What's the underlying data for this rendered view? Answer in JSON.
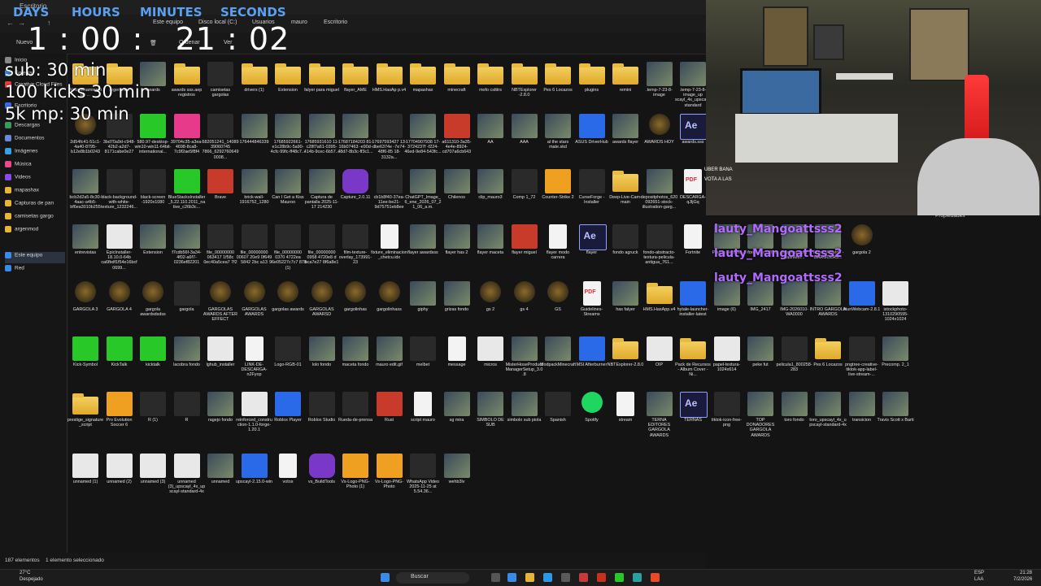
{
  "window": {
    "title": "Escritorio"
  },
  "address": {
    "back_icon": "arrow-left-icon",
    "crumbs": [
      "Este equipo",
      "Disco local (C:)",
      "Usuarios",
      "mauro",
      "Escritorio"
    ]
  },
  "cmdbar": {
    "new_label": "Nuevo",
    "sort_label": "Ordenar",
    "view_label": "Ver"
  },
  "sidebar": {
    "items": [
      {
        "label": "Inicio",
        "icon": "home-icon",
        "color": "#888888"
      },
      {
        "label": "Galería",
        "icon": "gallery-icon",
        "color": "#3a8ae8"
      },
      {
        "label": "Creative Cloud Files",
        "icon": "cloud-icon",
        "color": "#e83a3a"
      },
      {
        "label": "Escritorio",
        "icon": "desktop-icon",
        "color": "#3a6ae8"
      },
      {
        "label": "Descargas",
        "icon": "download-icon",
        "color": "#3a9a5a"
      },
      {
        "label": "Documentos",
        "icon": "documents-icon",
        "color": "#6a8ad8"
      },
      {
        "label": "Imágenes",
        "icon": "pictures-icon",
        "color": "#3aa0e8"
      },
      {
        "label": "Música",
        "icon": "music-icon",
        "color": "#e84a8a"
      },
      {
        "label": "Videos",
        "icon": "video-icon",
        "color": "#8a4ae8"
      },
      {
        "label": "mapashax",
        "icon": "folder-icon",
        "color": "#e8b43a"
      },
      {
        "label": "Capturas de pan",
        "icon": "folder-icon",
        "color": "#e8b43a"
      },
      {
        "label": "camisetas gargo",
        "icon": "folder-icon",
        "color": "#e8b43a"
      },
      {
        "label": "argenmod",
        "icon": "folder-icon",
        "color": "#e8b43a"
      },
      {
        "label": "Este equipo",
        "icon": "computer-icon",
        "color": "#3a8ae8"
      },
      {
        "label": "Red",
        "icon": "network-icon",
        "color": "#3a8ae8"
      }
    ]
  },
  "files": {
    "row1": [
      {
        "name": "Almacenamiento de ...",
        "kind": "folder"
      },
      {
        "name": "argenmod",
        "kind": "folder"
      },
      {
        "name": "awards",
        "kind": "img"
      },
      {
        "name": "awards sss.aep registros",
        "kind": "folder"
      },
      {
        "name": "camisetas gargolas",
        "kind": "dark"
      },
      {
        "name": "drivers (1)",
        "kind": "folder"
      },
      {
        "name": "Extension",
        "kind": "folder"
      },
      {
        "name": "falyer para miguel",
        "kind": "folder"
      },
      {
        "name": "flayer_AME",
        "kind": "folder"
      },
      {
        "name": "HMS.HasAp p.v4",
        "kind": "folder"
      },
      {
        "name": "mapashax",
        "kind": "folder"
      },
      {
        "name": "minecraft",
        "kind": "folder"
      },
      {
        "name": "mofo cstttrs",
        "kind": "folder"
      },
      {
        "name": "NBTExplorer -2.8.0",
        "kind": "folder"
      },
      {
        "name": "Pes 6 Locazos",
        "kind": "folder"
      },
      {
        "name": "plugins",
        "kind": "folder"
      },
      {
        "name": "remini",
        "kind": "folder"
      },
      {
        "name": ".temp-7-23-8-image",
        "kind": "img"
      },
      {
        "name": ".temp-7-23-8-image_up scayl_4x_upscayl-standard",
        "kind": "img"
      }
    ],
    "row2": [
      {
        "name": "2d54fc41-51c1-4a40-8795-b12e8b1b0243",
        "kind": "gold"
      },
      {
        "name": "3bd70a9d-c948-42b2-a2d7-8171cabe0e27",
        "kind": "dark"
      },
      {
        "name": "580.97-desktop-win10-win11-64bit-international...",
        "kind": "green"
      },
      {
        "name": "39704c35-a3ea-4698-8ca8-7c9f2ae5f8f4",
        "kind": "pink"
      },
      {
        "name": "582051241_1408939060745 7866_62927606490008...",
        "kind": "dark"
      },
      {
        "name": "176444846339",
        "kind": "img"
      },
      {
        "name": "17685922661-e1c28b9c-5a90-4cfc-99fc-ff48c7...",
        "kind": "img"
      },
      {
        "name": "17685931610 11-c28f7a61-0395-414b-9cec-6b57...",
        "kind": "img"
      },
      {
        "name": "17687184203 81-16b07463 -e90d-48d7-8b3c-ff3c1...",
        "kind": "img"
      },
      {
        "name": "17697593427 13-dbe6374e -7e74-48f6-85 18-3132a...",
        "kind": "dark"
      },
      {
        "name": "17704907938 17-3724237f -f224-46ed-9e84-543fc...",
        "kind": "img"
      },
      {
        "name": "a611310-3a35-4e4e-8924-cd707a6cb643",
        "kind": "red"
      },
      {
        "name": "AA",
        "kind": "img"
      },
      {
        "name": "AAA",
        "kind": "img"
      },
      {
        "name": "al the stars mate.skd",
        "kind": "img"
      },
      {
        "name": "ASUS DriverHub",
        "kind": "blue"
      },
      {
        "name": "awards flayer",
        "kind": "img"
      },
      {
        "name": "AWARDS HOY",
        "kind": "gold"
      },
      {
        "name": "awards.sss",
        "kind": "ae"
      }
    ],
    "row3": [
      {
        "name": "bcb2d2a5-8c30-4aac-a4b5-bf6ea3010b255",
        "kind": "img"
      },
      {
        "name": "black-background-with-white-texture_1232246...",
        "kind": "dark"
      },
      {
        "name": "black-screen -1920x1080",
        "kind": "dark"
      },
      {
        "name": "BlueStacksInstaller_5.22.110.2011_native_c26b3c...",
        "kind": "green"
      },
      {
        "name": "Brave",
        "kind": "red"
      },
      {
        "name": "brick-wall-1916752_1280",
        "kind": "img"
      },
      {
        "name": "Can I Get a Kiss Mauroo",
        "kind": "img"
      },
      {
        "name": "Captura de pantalla 2025-11-17 214230",
        "kind": "img"
      },
      {
        "name": "Capture_2.0.11",
        "kind": "purple"
      },
      {
        "name": "cb1b8f40-37ea-11ee-be21-9d75751eb8ee",
        "kind": "dark"
      },
      {
        "name": "ChatGPT_Image_6_ene_2026_07_21_06_a.m.",
        "kind": "img"
      },
      {
        "name": "Chilenos",
        "kind": "img"
      },
      {
        "name": "clip_mauro3",
        "kind": "img"
      },
      {
        "name": "Comp 1_72",
        "kind": "dark"
      },
      {
        "name": "Counter-Strike 2",
        "kind": "orange"
      },
      {
        "name": "CurseForge - Installer",
        "kind": "dark"
      },
      {
        "name": "Deep-Live-Cam-main",
        "kind": "folder"
      },
      {
        "name": "depositphotos_620092651-stock-illustration-garg...",
        "kind": "img"
      },
      {
        "name": "DESCARGA-qJljGq",
        "kind": "pdf"
      }
    ],
    "row4": [
      {
        "name": "entrevistas",
        "kind": "img"
      },
      {
        "name": "EpicInstaller-18.10.0-64b ca6fbdf1f54e16bcf0699...",
        "kind": "white"
      },
      {
        "name": "Extension",
        "kind": "img"
      },
      {
        "name": "f7cdb56f-3a34-4f02-a6f7-0236ef82201",
        "kind": "img"
      },
      {
        "name": "file_00000000 063417 1f58c 0ec40a5cea7 7f2",
        "kind": "dark"
      },
      {
        "name": "file_00000000 00607 20e9 0f649 5842 2bc a13",
        "kind": "dark"
      },
      {
        "name": "file_00000000 0370 4722ea 96e05227c7c7 878 (1)",
        "kind": "dark"
      },
      {
        "name": "file_00000000 0958 4720e8 d bca7e27 8f6a8e1",
        "kind": "dark"
      },
      {
        "name": "film-texture-overlay_173991-23",
        "kind": "dark"
      },
      {
        "name": "fixture_eliminacion_chetcu.idx",
        "kind": "doc"
      },
      {
        "name": "flayer awardsss",
        "kind": "img"
      },
      {
        "name": "flayer has 2",
        "kind": "img"
      },
      {
        "name": "flayer maceta",
        "kind": "img"
      },
      {
        "name": "flayer miguel",
        "kind": "red"
      },
      {
        "name": "flayer modo carrera",
        "kind": "doc"
      },
      {
        "name": "flayer",
        "kind": "ae"
      },
      {
        "name": "fondo agruck",
        "kind": "dark"
      },
      {
        "name": "fondo-abstracto-textura-pelicula-antigua_761...",
        "kind": "dark"
      },
      {
        "name": "Fortnite",
        "kind": "doc"
      }
    ],
    "row4b": [
      {
        "name": "Plastic-Texture",
        "kind": "img"
      },
      {
        "name": "2-forge-mc1 20.1",
        "kind": "img"
      },
      {
        "name": "Bazinga from HashMer...",
        "kind": "img"
      },
      {
        "name": "Touze (Awards - GARGOLAS...",
        "kind": "img"
      },
      {
        "name": "gargola 2",
        "kind": "gold"
      }
    ],
    "row5": [
      {
        "name": "GARGOLA 3",
        "kind": "gold"
      },
      {
        "name": "GARGOLA 4",
        "kind": "gold"
      },
      {
        "name": "gargola awardsdsdss",
        "kind": "gold"
      },
      {
        "name": "gargola",
        "kind": "dark"
      },
      {
        "name": "GARGOLAS AWARDS AFTER EFFECT",
        "kind": "gold"
      },
      {
        "name": "GARGOLAS AWARDS",
        "kind": "gold"
      },
      {
        "name": "gargolas awards",
        "kind": "gold"
      },
      {
        "name": "GARGOLAS AWARSD",
        "kind": "gold"
      },
      {
        "name": "gargolinhas",
        "kind": "gold"
      },
      {
        "name": "gargolinhass",
        "kind": "gold"
      },
      {
        "name": "giphy",
        "kind": "img"
      },
      {
        "name": "grizas fondo",
        "kind": "img"
      },
      {
        "name": "gs 2",
        "kind": "gold"
      },
      {
        "name": "gs 4",
        "kind": "gold"
      },
      {
        "name": "GS",
        "kind": "gold"
      },
      {
        "name": "Guidelines-Streams",
        "kind": "pdf"
      },
      {
        "name": "has falyer",
        "kind": "img"
      },
      {
        "name": "HMS.HasApp.v4",
        "kind": "folder"
      },
      {
        "name": "hytale-launcher-installer-latest",
        "kind": "blue"
      },
      {
        "name": "image (6)",
        "kind": "img"
      },
      {
        "name": "IMG_2417",
        "kind": "img"
      },
      {
        "name": "IMG-2026010-WA0000",
        "kind": "img"
      },
      {
        "name": "INTRO GARGOLA AWARDS",
        "kind": "img"
      },
      {
        "name": "IriunWebcam-2.8.1",
        "kind": "blue"
      },
      {
        "name": "istockphoto-1310290595-1024x1024",
        "kind": "white"
      }
    ],
    "row6": [
      {
        "name": "Kick-Symbol",
        "kind": "green"
      },
      {
        "name": "KickTalk",
        "kind": "green"
      },
      {
        "name": "kicktalk",
        "kind": "green"
      },
      {
        "name": "lacobra fondo",
        "kind": "img"
      },
      {
        "name": "lghub_installer",
        "kind": "white"
      },
      {
        "name": "LINK-DE-DESCARGA-n2Fyop",
        "kind": "doc"
      },
      {
        "name": "Logo-RGB-01",
        "kind": "dark"
      },
      {
        "name": "lolo fondo",
        "kind": "img"
      },
      {
        "name": "maceta fondo",
        "kind": "img"
      },
      {
        "name": "mauro edit.gif",
        "kind": "img"
      },
      {
        "name": "melbet",
        "kind": "dark"
      },
      {
        "name": "message",
        "kind": "doc"
      },
      {
        "name": "micros",
        "kind": "white"
      },
      {
        "name": "MisterHoseProductManagerSetup_3.0.8",
        "kind": "img"
      },
      {
        "name": "ModpackMinecraft",
        "kind": "img"
      },
      {
        "name": "MSI Afterburner",
        "kind": "blue"
      },
      {
        "name": "NBTExplorer-2.8.0",
        "kind": "folder"
      },
      {
        "name": "OIP",
        "kind": "white"
      },
      {
        "name": "Pack de Recursos - Album Cover - Ni...",
        "kind": "folder"
      },
      {
        "name": "papel-textura-1024x614",
        "kind": "white"
      },
      {
        "name": "peke fut",
        "kind": "img"
      },
      {
        "name": "pelicula1_800258-283",
        "kind": "dark"
      },
      {
        "name": "Pes 6 Locazos",
        "kind": "folder"
      },
      {
        "name": "pngtree-creative-tiktok-app-label-live-stream-...",
        "kind": "dark"
      },
      {
        "name": "Precomp. 2_1",
        "kind": "img"
      }
    ],
    "row7": [
      {
        "name": "prestige_signature_script",
        "kind": "folder"
      },
      {
        "name": "Pro Evolution Soccer 6",
        "kind": "orange"
      },
      {
        "name": "R (1)",
        "kind": "dark"
      },
      {
        "name": "R",
        "kind": "dark"
      },
      {
        "name": "ragejo fondo",
        "kind": "img"
      },
      {
        "name": "reinforced_construction-1.1.0-forge-1.20.1",
        "kind": "white"
      },
      {
        "name": "Roblox Player",
        "kind": "blue"
      },
      {
        "name": "Roblox Studio",
        "kind": "dark"
      },
      {
        "name": "Rueda-de-prensa",
        "kind": "dark"
      },
      {
        "name": "Rust",
        "kind": "red"
      },
      {
        "name": "script mauro",
        "kind": "doc"
      },
      {
        "name": "sg mira",
        "kind": "img"
      },
      {
        "name": "SIMBOLO DE SUB",
        "kind": "img"
      },
      {
        "name": "simbolo sub piola",
        "kind": "img"
      },
      {
        "name": "Spanish",
        "kind": "dark"
      },
      {
        "name": "Spotify",
        "kind": "spotify"
      },
      {
        "name": "stream",
        "kind": "doc"
      },
      {
        "name": "TERNA EDITORES GARGOLA AWARDS",
        "kind": "img"
      },
      {
        "name": "TERNAS",
        "kind": "ae"
      },
      {
        "name": "tiktok-icon-free-png",
        "kind": "dark"
      },
      {
        "name": "TOP DONADORES GARGOLA AWARDS",
        "kind": "img"
      },
      {
        "name": "toro fondo",
        "kind": "img"
      },
      {
        "name": "toro_upscayl_4x_upscayl-standard-4x",
        "kind": "img"
      },
      {
        "name": "transicion",
        "kind": "img"
      },
      {
        "name": "Travis Scott x Barti",
        "kind": "img"
      }
    ],
    "row8": [
      {
        "name": "unnamed (1)",
        "kind": "white"
      },
      {
        "name": "unnamed (2)",
        "kind": "white"
      },
      {
        "name": "unnamed (3)",
        "kind": "white"
      },
      {
        "name": "unnamed (3)_upscayl_4x_upscayl-standard-4x",
        "kind": "white"
      },
      {
        "name": "unnamed",
        "kind": "img"
      },
      {
        "name": "upscayl-2.15.0-win",
        "kind": "blue"
      },
      {
        "name": "votos",
        "kind": "doc"
      },
      {
        "name": "vs_BuildTools",
        "kind": "purple"
      },
      {
        "name": "Vs-Logo-PNG-Photo (1)",
        "kind": "orange"
      },
      {
        "name": "Vs-Logo-PNG-Photo",
        "kind": "orange"
      },
      {
        "name": "WhatsApp Video 2025-11-25 at 5.54.36...",
        "kind": "dark"
      },
      {
        "name": "wehb3lv",
        "kind": "img"
      }
    ]
  },
  "status": {
    "count": "187 elementos",
    "selected": "1 elemento seleccionado"
  },
  "properties_label": "Propiedades",
  "overlay": {
    "heads": [
      "DAYS",
      "HOURS",
      "MINUTES",
      "SECONDS"
    ],
    "timer": "1 : 00 :   21 : 02",
    "goals": [
      "sub: 30 min",
      "100 kicks 30 min",
      "5k mp: 30 min"
    ],
    "alerts": [
      "lauty_Mangoattsss2",
      "lauty_Mangoattsss2",
      "lauty_Mangoattsss2"
    ],
    "chat": [
      "UBER BANA",
      "VOTA A LAS"
    ]
  },
  "taskbar": {
    "weather_temp": "27°C",
    "weather_desc": "Despejado",
    "search": "Buscar",
    "lang": "ESP",
    "region": "LAA",
    "time": "21:28",
    "date": "7/2/2026"
  }
}
